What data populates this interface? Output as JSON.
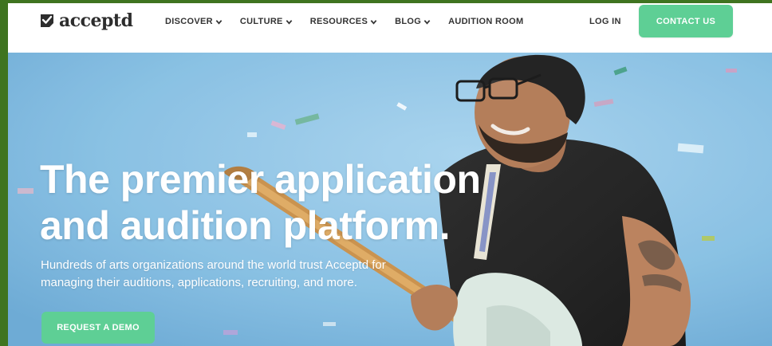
{
  "header": {
    "logo_text": "acceptd",
    "nav": [
      {
        "label": "DISCOVER",
        "has_dropdown": true
      },
      {
        "label": "CULTURE",
        "has_dropdown": true
      },
      {
        "label": "RESOURCES",
        "has_dropdown": true
      },
      {
        "label": "BLOG",
        "has_dropdown": true
      },
      {
        "label": "AUDITION ROOM",
        "has_dropdown": false
      }
    ],
    "login_label": "LOG IN",
    "contact_label": "CONTACT US"
  },
  "hero": {
    "title_line1": "The premier application",
    "title_line2": "and audition platform.",
    "subtitle_line1": "Hundreds of arts organizations around the world trust Acceptd for",
    "subtitle_line2": "managing their auditions, applications, recruiting, and more.",
    "cta_label": "REQUEST A DEMO"
  },
  "colors": {
    "accent": "#5ecf95",
    "hero_bg": "#86bfe3",
    "window_border": "#3f7420"
  }
}
